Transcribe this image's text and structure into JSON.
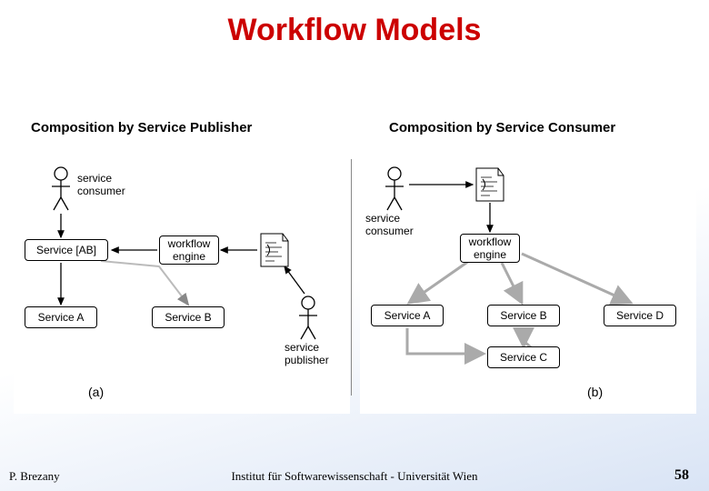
{
  "title": "Workflow Models",
  "subtitles": {
    "left": "Composition by Service Publisher",
    "right": "Composition by Service Consumer"
  },
  "panel_a": {
    "service_consumer": "service\nconsumer",
    "service_ab": "Service [AB]",
    "workflow_engine": "workflow\nengine",
    "service_a": "Service A",
    "service_b": "Service B",
    "service_publisher": "service\npublisher",
    "label": "(a)"
  },
  "panel_b": {
    "service_consumer": "service\nconsumer",
    "workflow_engine": "workflow\nengine",
    "service_a": "Service A",
    "service_b": "Service B",
    "service_c": "Service C",
    "service_d": "Service D",
    "label": "(b)"
  },
  "footer": {
    "author": "P. Brezany",
    "institute": "Institut für Softwarewissenschaft - Universität Wien",
    "page": "58"
  }
}
